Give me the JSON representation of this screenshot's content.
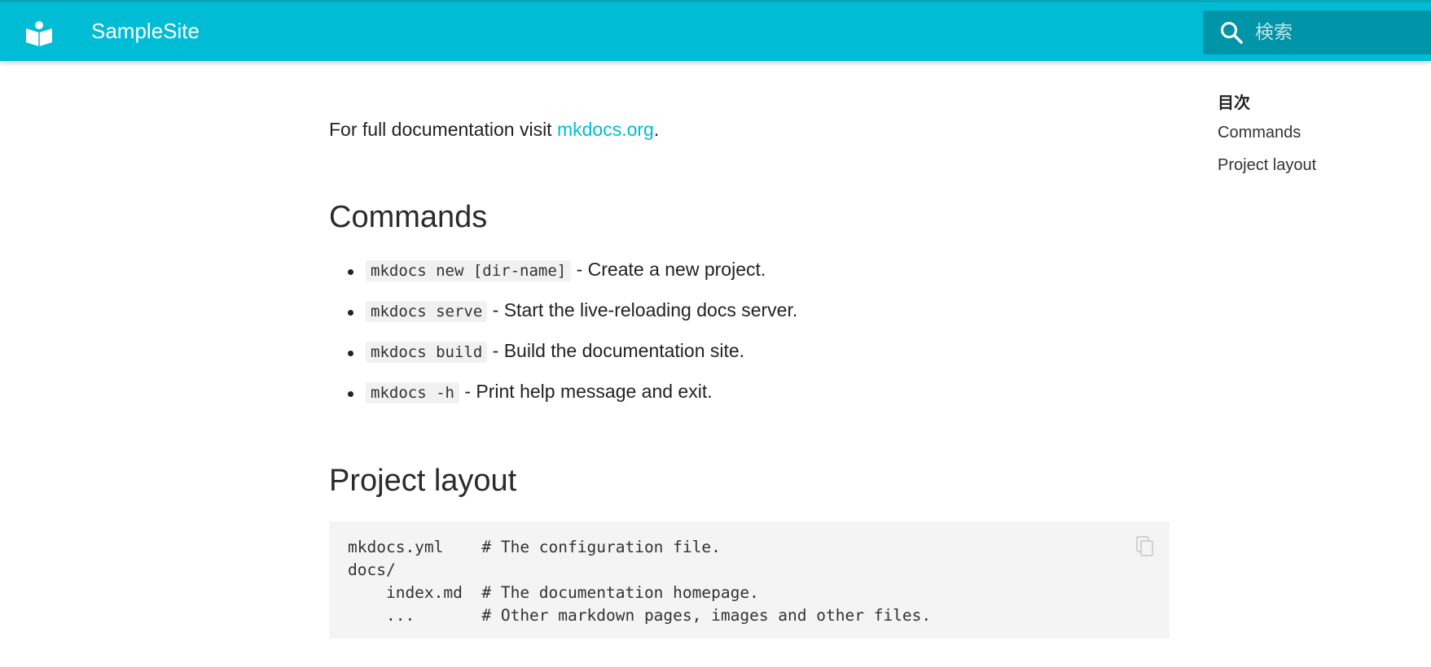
{
  "header": {
    "site_name": "SampleSite",
    "search_placeholder": "検索",
    "brand_color": "#00bcd4"
  },
  "intro": {
    "text_before": "For full documentation visit ",
    "link_text": "mkdocs.org",
    "text_after": "."
  },
  "sections": {
    "commands_title": "Commands",
    "layout_title": "Project layout"
  },
  "commands": [
    {
      "code": "mkdocs new [dir-name]",
      "desc": " - Create a new project."
    },
    {
      "code": "mkdocs serve",
      "desc": " - Start the live-reloading docs server."
    },
    {
      "code": "mkdocs build",
      "desc": " - Build the documentation site."
    },
    {
      "code": "mkdocs -h",
      "desc": " - Print help message and exit."
    }
  ],
  "code_block": {
    "lines": [
      "mkdocs.yml    # The configuration file.",
      "docs/",
      "    index.md  # The documentation homepage.",
      "    ...       # Other markdown pages, images and other files."
    ],
    "copy_icon": "copy-icon"
  },
  "toc": {
    "title": "目次",
    "items": [
      "Commands",
      "Project layout"
    ]
  }
}
